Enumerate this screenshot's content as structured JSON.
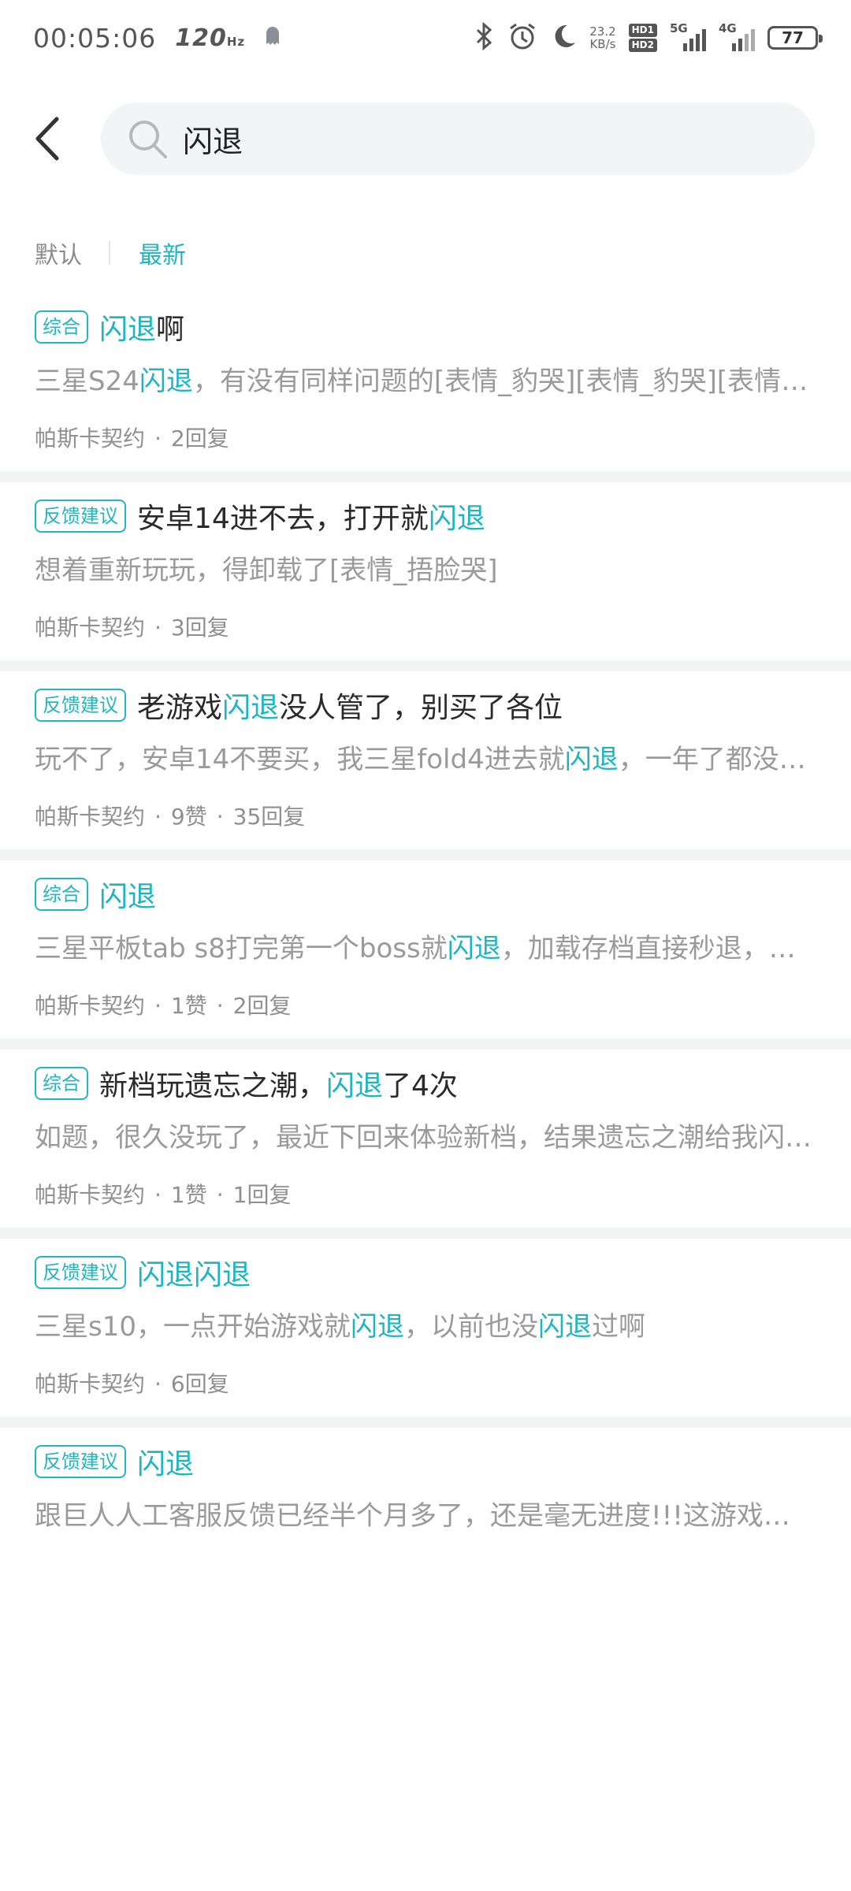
{
  "status_bar": {
    "time": "00:05:06",
    "refresh_rate": "120",
    "refresh_unit": "Hz",
    "net_speed_value": "23.2",
    "net_speed_unit": "KB/s",
    "hd1": "HD1",
    "hd2": "HD2",
    "net_5g": "5G",
    "net_4g": "4G",
    "battery": "77"
  },
  "search": {
    "query": "闪退"
  },
  "sort_tabs": {
    "default": "默认",
    "newest": "最新",
    "active": "newest"
  },
  "posts": [
    {
      "tag": "综合",
      "title_parts": [
        {
          "t": "闪退",
          "hl": true
        },
        {
          "t": "啊",
          "hl": false
        }
      ],
      "body_parts": [
        {
          "t": "三星S24",
          "hl": false
        },
        {
          "t": "闪退",
          "hl": true
        },
        {
          "t": "，有没有同样问题的[表情_豹哭][表情_豹哭][表情_豹哭]",
          "hl": false
        }
      ],
      "author": "帕斯卡契约",
      "likes": "",
      "replies": "2回复"
    },
    {
      "tag": "反馈建议",
      "title_parts": [
        {
          "t": "安卓14进不去，打开就",
          "hl": false
        },
        {
          "t": "闪退",
          "hl": true
        }
      ],
      "body_parts": [
        {
          "t": "想着重新玩玩，得卸载了[表情_捂脸哭]",
          "hl": false
        }
      ],
      "author": "帕斯卡契约",
      "likes": "",
      "replies": "3回复"
    },
    {
      "tag": "反馈建议",
      "title_parts": [
        {
          "t": "老游戏",
          "hl": false
        },
        {
          "t": "闪退",
          "hl": true
        },
        {
          "t": "没人管了，别买了各位",
          "hl": false
        }
      ],
      "body_parts": [
        {
          "t": "玩不了，安卓14不要买，我三星fold4进去就",
          "hl": false
        },
        {
          "t": "闪退",
          "hl": true
        },
        {
          "t": "，一年了都没修复",
          "hl": false
        }
      ],
      "author": "帕斯卡契约",
      "likes": "9赞",
      "replies": "35回复"
    },
    {
      "tag": "综合",
      "title_parts": [
        {
          "t": "闪退",
          "hl": true
        }
      ],
      "body_parts": [
        {
          "t": "三星平板tab s8打完第一个boss就",
          "hl": false
        },
        {
          "t": "闪退",
          "hl": true
        },
        {
          "t": "，加载存档直接秒退，怎么办",
          "hl": false
        }
      ],
      "author": "帕斯卡契约",
      "likes": "1赞",
      "replies": "2回复"
    },
    {
      "tag": "综合",
      "title_parts": [
        {
          "t": "新档玩遗忘之潮，",
          "hl": false
        },
        {
          "t": "闪退",
          "hl": true
        },
        {
          "t": "了4次",
          "hl": false
        }
      ],
      "body_parts": [
        {
          "t": "如题，很久没玩了，最近下回来体验新档，结果遗忘之潮给我闪退了四次",
          "hl": false
        }
      ],
      "author": "帕斯卡契约",
      "likes": "1赞",
      "replies": "1回复"
    },
    {
      "tag": "反馈建议",
      "title_parts": [
        {
          "t": "闪退闪退",
          "hl": true
        }
      ],
      "body_parts": [
        {
          "t": "三星s10，一点开始游戏就",
          "hl": false
        },
        {
          "t": "闪退",
          "hl": true
        },
        {
          "t": "，以前也没",
          "hl": false
        },
        {
          "t": "闪退",
          "hl": true
        },
        {
          "t": "过啊",
          "hl": false
        }
      ],
      "author": "帕斯卡契约",
      "likes": "",
      "replies": "6回复"
    },
    {
      "tag": "反馈建议",
      "title_parts": [
        {
          "t": "闪退",
          "hl": true
        }
      ],
      "body_parts": [
        {
          "t": "跟巨人人工客服反馈已经半个月多了，还是毫无进度!!!这游戏还有人管吗",
          "hl": false
        }
      ],
      "author": "",
      "likes": "",
      "replies": ""
    }
  ]
}
